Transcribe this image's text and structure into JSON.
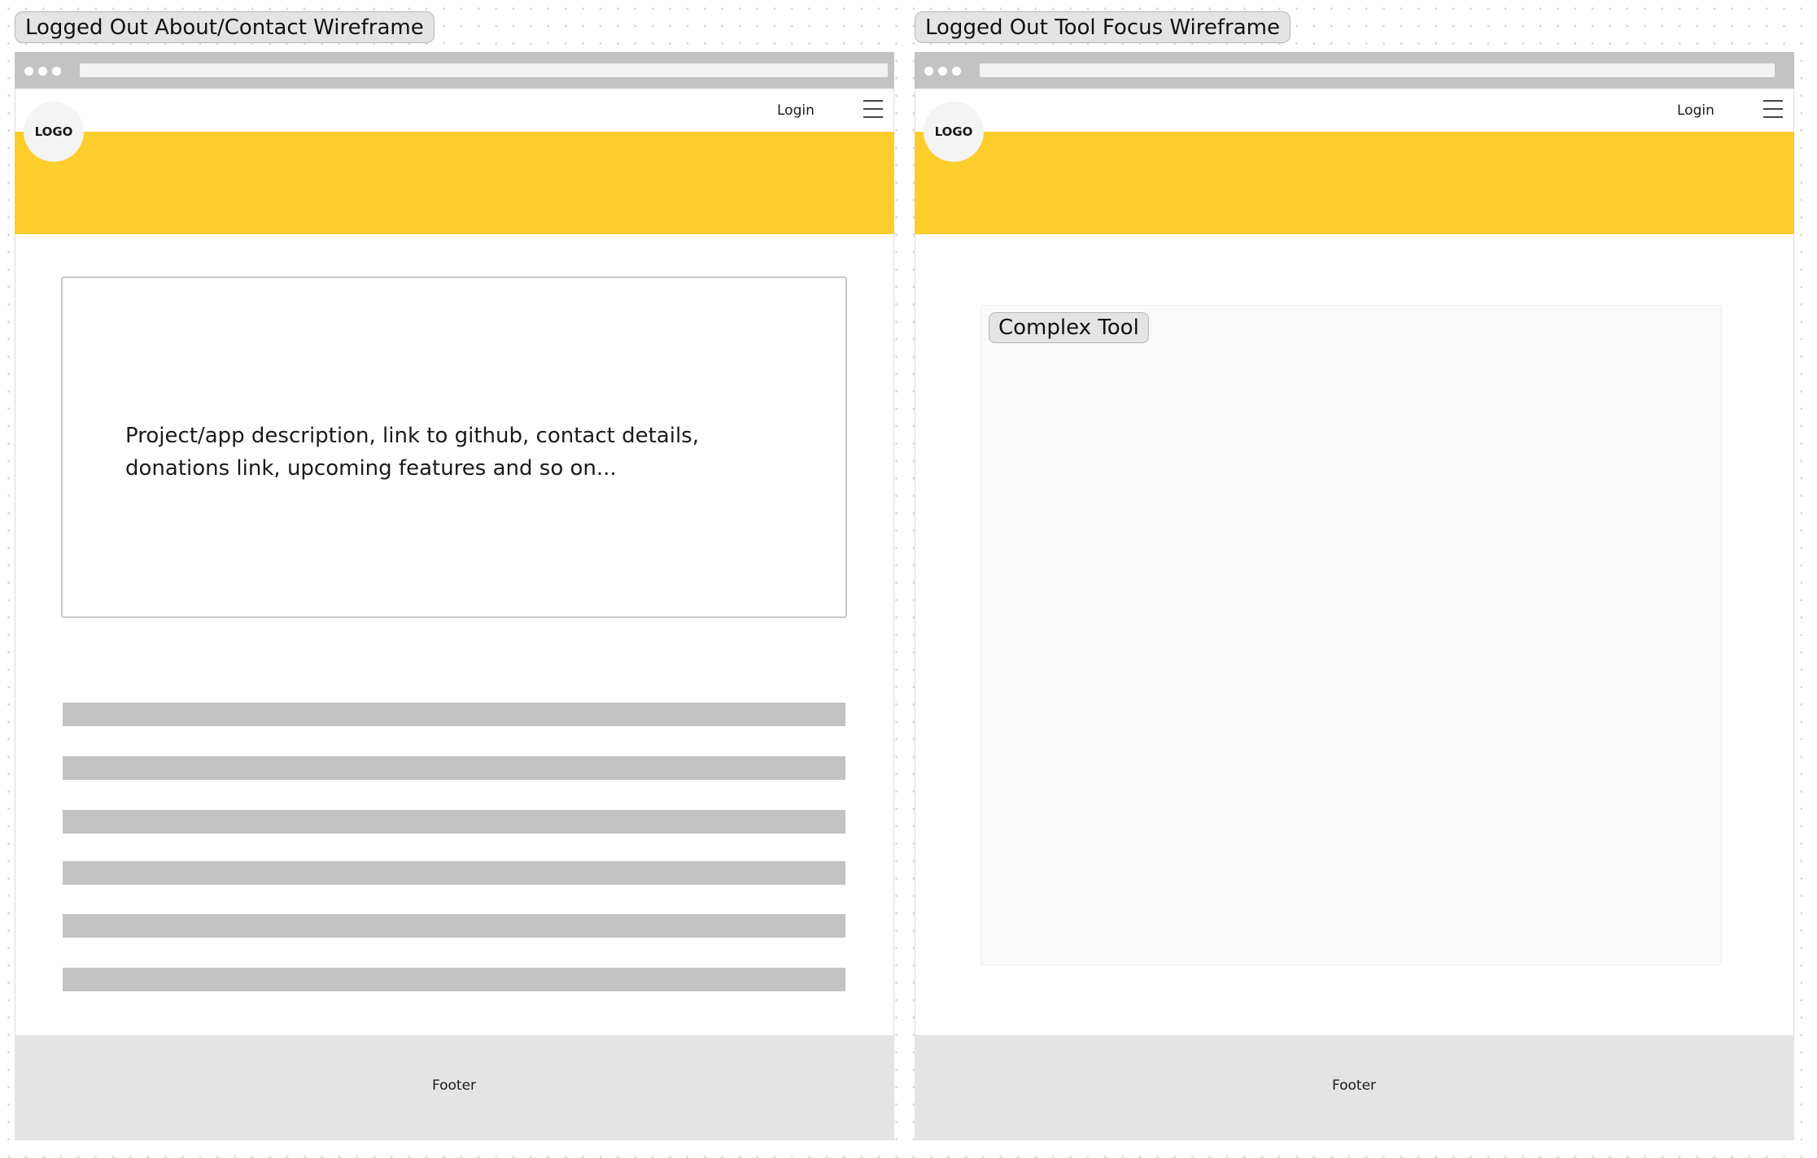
{
  "canvas": {
    "background": "#ffffff",
    "grid_dot_color": "#d6d6d6"
  },
  "colors": {
    "hero_yellow": "#fdcd2b",
    "chrome_gray": "#c3c3c3",
    "placeholder_bar_gray": "#c2c2c2",
    "footer_gray": "#e4e4e4",
    "label_bg": "#e4e4e4"
  },
  "frames": [
    {
      "label": "Logged Out About/Contact Wireframe",
      "nav": {
        "logo": "LOGO",
        "login": "Login",
        "menu_icon": "hamburger-menu-icon"
      },
      "content": {
        "description": "Project/app description, link to github, contact details, donations link, upcoming features and so on...",
        "text_line_placeholders": 6
      },
      "footer": "Footer"
    },
    {
      "label": "Logged Out Tool Focus Wireframe",
      "nav": {
        "logo": "LOGO",
        "login": "Login",
        "menu_icon": "hamburger-menu-icon"
      },
      "content": {
        "tool_label": "Complex Tool"
      },
      "footer": "Footer"
    }
  ]
}
